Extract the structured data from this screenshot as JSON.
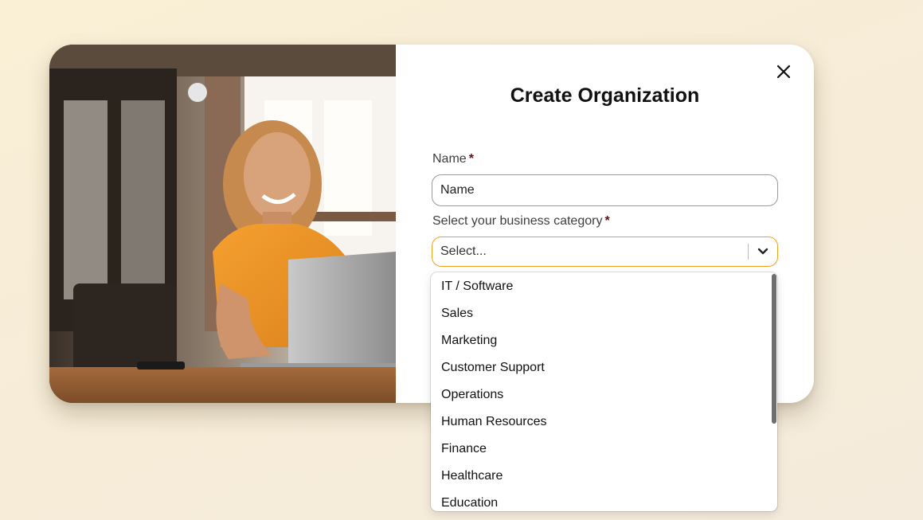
{
  "dialog": {
    "title": "Create Organization",
    "close_icon": "close-icon"
  },
  "form": {
    "name": {
      "label": "Name",
      "required_marker": "*",
      "placeholder": "Name"
    },
    "category": {
      "label": "Select your business category",
      "required_marker": "*",
      "placeholder": "Select...",
      "chevron_icon": "chevron-down-icon",
      "focus_color": "#f0a020"
    }
  },
  "dropdown": {
    "options": [
      "IT / Software",
      "Sales",
      "Marketing",
      "Customer Support",
      "Operations",
      "Human Resources",
      "Finance",
      "Healthcare",
      "Education"
    ]
  }
}
